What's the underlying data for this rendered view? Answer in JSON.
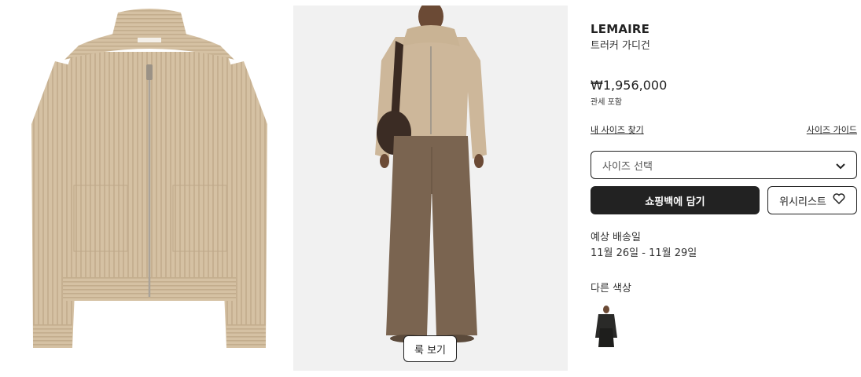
{
  "product": {
    "brand": "LEMAIRE",
    "name": "트러커 가디건",
    "price": "₩1,956,000",
    "tax_note": "관세 포함"
  },
  "links": {
    "find_size": "내 사이즈 찾기",
    "size_guide": "사이즈 가이드"
  },
  "size_select": {
    "placeholder": "사이즈 선택"
  },
  "actions": {
    "add_to_bag": "쇼핑백에 담기",
    "wishlist": "위시리스트",
    "look": "룩 보기"
  },
  "shipping": {
    "label": "예상 배송일",
    "date": "11월 26일 - 11월 29일"
  },
  "colors": {
    "label": "다른 색상"
  },
  "icons": [
    "chevron-down-icon",
    "heart-icon"
  ],
  "colors_palette": {
    "knit": "#d6c2a5",
    "pants": "#7a6450",
    "button_dark": "#222222"
  }
}
